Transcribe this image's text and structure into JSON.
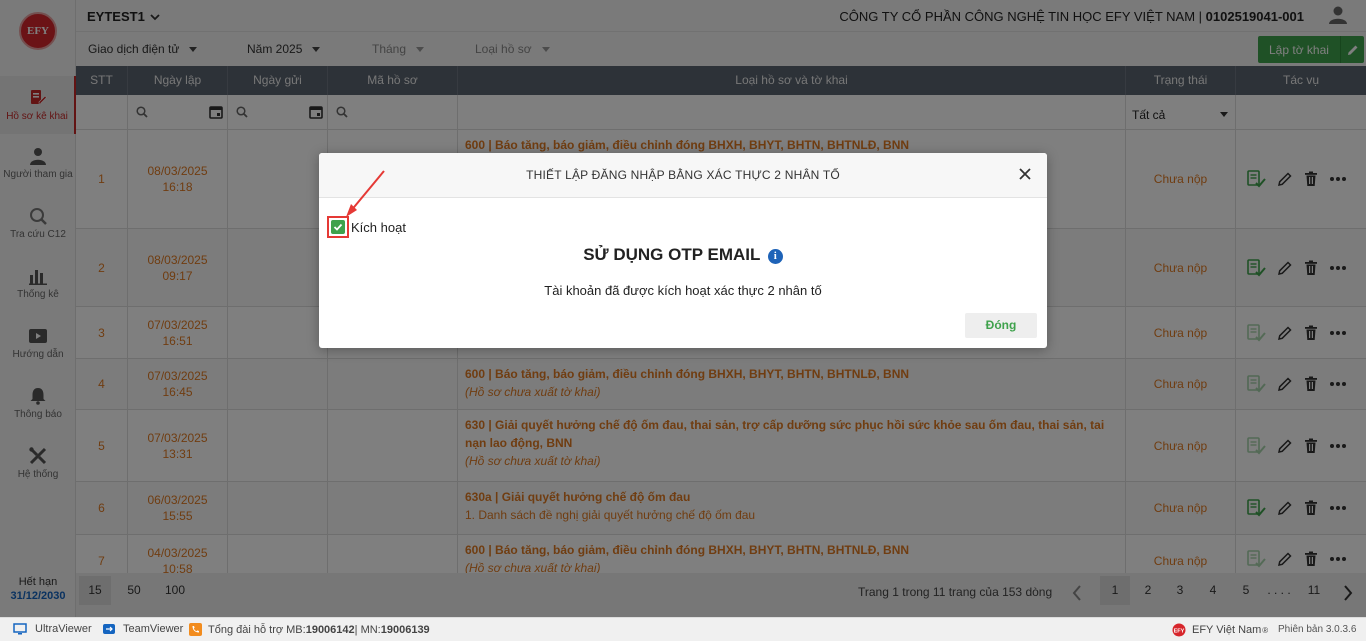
{
  "topbar": {
    "account": "EYTEST1",
    "company_name": "CÔNG TY CỔ PHẦN CÔNG NGHỆ TIN HỌC EFY VIỆT NAM",
    "separator": " | ",
    "tax_code": "0102519041-001"
  },
  "logo": "EFY",
  "sidebar": {
    "items": [
      {
        "label": "Hồ sơ kê khai",
        "icon": "document-edit-icon"
      },
      {
        "label": "Người tham gia",
        "icon": "person-icon"
      },
      {
        "label": "Tra cứu C12",
        "icon": "search-icon"
      },
      {
        "label": "Thống kê",
        "icon": "bar-chart-icon"
      },
      {
        "label": "Hướng dẫn",
        "icon": "video-guide-icon"
      },
      {
        "label": "Thông báo",
        "icon": "bell-icon"
      },
      {
        "label": "Hệ thống",
        "icon": "tools-icon"
      }
    ],
    "expiry_label": "Hết hạn",
    "expiry_date": "31/12/2030"
  },
  "filters": {
    "type": "Giao dịch điện tử",
    "year": "Năm 2025",
    "month": "Tháng",
    "form_type": "Loại hồ sơ",
    "create_button": "Lập tờ khai"
  },
  "table": {
    "headers": [
      "STT",
      "Ngày lập",
      "Ngày gửi",
      "Mã hồ sơ",
      "Loại hồ sơ và tờ khai",
      "Trạng thái",
      "Tác vụ"
    ],
    "status_filter": "Tất cả",
    "rows": [
      {
        "stt": "1",
        "date": "08/03/2025",
        "time": "16:18",
        "title": "600 | Báo tăng, báo giảm, điều chỉnh đóng BHXH, BHYT, BHTN, BHTNLĐ, BNN",
        "sub": "",
        "status": "Chưa nộp"
      },
      {
        "stt": "2",
        "date": "08/03/2025",
        "time": "09:17",
        "title": "",
        "sub": "",
        "status": "Chưa nộp"
      },
      {
        "stt": "3",
        "date": "07/03/2025",
        "time": "16:51",
        "title": "",
        "sub": "",
        "status": "Chưa nộp"
      },
      {
        "stt": "4",
        "date": "07/03/2025",
        "time": "16:45",
        "title": "600 | Báo tăng, báo giảm, điều chỉnh đóng BHXH, BHYT, BHTN, BHTNLĐ, BNN",
        "sub": "(Hồ sơ chưa xuất tờ khai)",
        "status": "Chưa nộp"
      },
      {
        "stt": "5",
        "date": "07/03/2025",
        "time": "13:31",
        "title": "630 | Giải quyết hưởng chế độ ốm đau, thai sản, trợ cấp dưỡng sức phục hồi sức khỏe sau ốm đau, thai sản, tai nạn lao động, BNN",
        "sub": "(Hồ sơ chưa xuất tờ khai)",
        "status": "Chưa nộp"
      },
      {
        "stt": "6",
        "date": "06/03/2025",
        "time": "15:55",
        "title": "630a | Giải quyết hưởng chế độ ốm đau",
        "note": "1. Danh sách đề nghị giải quyết hưởng chế độ ốm đau",
        "status": "Chưa nộp"
      },
      {
        "stt": "7",
        "date": "04/03/2025",
        "time": "10:58",
        "title": "600 | Báo tăng, báo giảm, điều chỉnh đóng BHXH, BHYT, BHTN, BHTNLĐ, BNN",
        "sub": "(Hồ sơ chưa xuất tờ khai)",
        "status": "Chưa nộp"
      }
    ]
  },
  "pagination": {
    "sizes": [
      "15",
      "50",
      "100"
    ],
    "info": "Trang 1 trong 11 trang của 153 dòng",
    "pages": [
      "1",
      "2",
      "3",
      "4",
      "5",
      ". . . .",
      "11"
    ]
  },
  "bottombar": {
    "ultraviewer": "UltraViewer",
    "teamviewer": "TeamViewer",
    "hotline_label": "Tổng đài hỗ trợ MB: ",
    "hotline_mb": "19006142",
    "hotline_sep": " | MN: ",
    "hotline_mn": "19006139",
    "brand": "EFY Việt Nam",
    "version": "Phiên bản 3.0.3.6"
  },
  "modal": {
    "title": "THIẾT LẬP ĐĂNG NHẬP BẰNG XÁC THỰC 2 NHÂN TỐ",
    "checkbox_label": "Kích hoạt",
    "checked": true,
    "heading": "SỬ DỤNG OTP EMAIL",
    "message": "Tài khoản đã được kích hoạt xác thực 2 nhân tố",
    "close_button": "Đóng"
  },
  "colors": {
    "brand_red": "#d7262c",
    "accent_green": "#3fa24c",
    "row_orange": "#e07a22",
    "header_gray": "#5a6470",
    "annotation_red": "#e53935"
  }
}
